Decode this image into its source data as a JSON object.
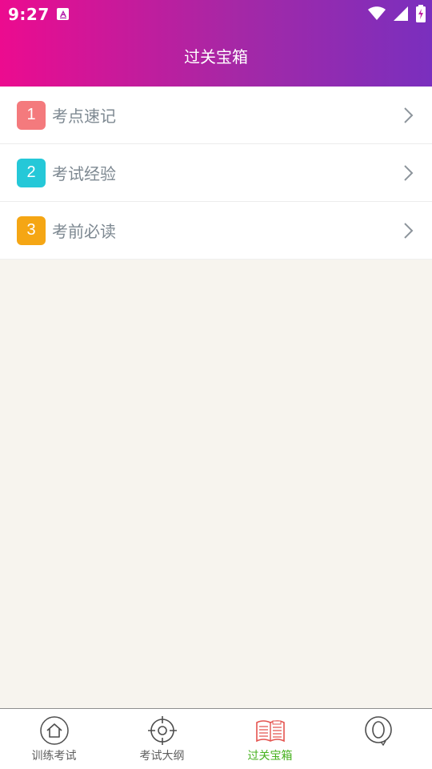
{
  "status_bar": {
    "time": "9:27"
  },
  "header": {
    "title": "过关宝箱",
    "gradient_start": "#ec0b8f",
    "gradient_end": "#7a2fbe"
  },
  "menu": [
    {
      "number": "1",
      "label": "考点速记",
      "badge_color": "#f47a7d",
      "icon": "chevron-right-icon"
    },
    {
      "number": "2",
      "label": "考试经验",
      "badge_color": "#25c8d8",
      "icon": "chevron-right-icon"
    },
    {
      "number": "3",
      "label": "考前必读",
      "badge_color": "#f5a614",
      "icon": "chevron-right-icon"
    }
  ],
  "bottom_nav": [
    {
      "label": "训练考试",
      "icon": "home-icon",
      "active": false
    },
    {
      "label": "考试大纲",
      "icon": "target-icon",
      "active": false
    },
    {
      "label": "过关宝箱",
      "icon": "news-book-icon",
      "active": true
    },
    {
      "label": "",
      "icon": "profile-icon",
      "active": false
    }
  ],
  "colors": {
    "background": "#f7f4ee",
    "active_tab": "#46b11e",
    "inactive_tab": "#5e5e5e",
    "menu_text": "#7d8891"
  }
}
